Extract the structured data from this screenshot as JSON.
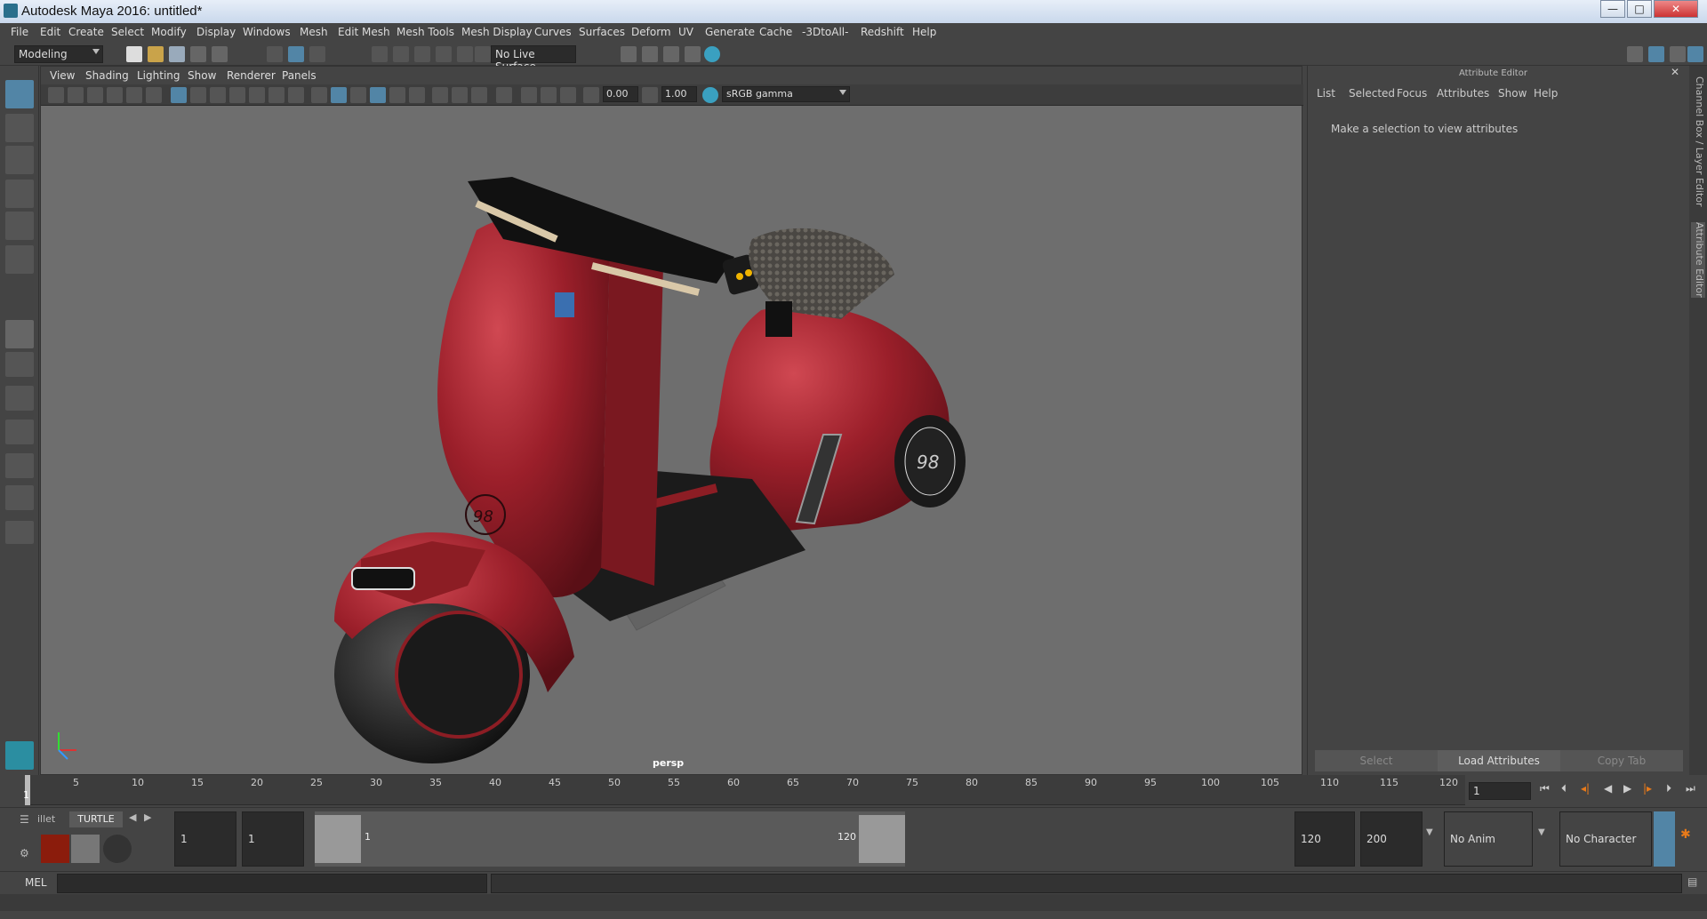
{
  "window": {
    "title": "Autodesk Maya 2016: untitled*",
    "minimize": "—",
    "maximize": "□",
    "close": "✕"
  },
  "menu": [
    "File",
    "Edit",
    "Create",
    "Select",
    "Modify",
    "Display",
    "Windows",
    "Mesh",
    "Edit Mesh",
    "Mesh Tools",
    "Mesh Display",
    "Curves",
    "Surfaces",
    "Deform",
    "UV",
    "Generate",
    "Cache",
    "-3DtoAll-",
    "Redshift",
    "Help"
  ],
  "status": {
    "menuset": "Modeling",
    "live_surface": "No Live Surface"
  },
  "panel_menu": [
    "View",
    "Shading",
    "Lighting",
    "Show",
    "Renderer",
    "Panels"
  ],
  "panel_bar": {
    "value_a": "0.00",
    "value_b": "1.00",
    "color_space": "sRGB gamma"
  },
  "viewport": {
    "camera": "persp"
  },
  "attribute_editor": {
    "title": "Attribute Editor",
    "menus": [
      "List",
      "Selected",
      "Focus",
      "Attributes",
      "Show",
      "Help"
    ],
    "message": "Make a selection to view attributes",
    "buttons": {
      "select": "Select",
      "load": "Load Attributes",
      "copy": "Copy Tab"
    }
  },
  "side_tabs": {
    "channel_box": "Channel Box / Layer Editor",
    "attribute_editor": "Attribute Editor"
  },
  "timeline": {
    "ticks": [
      "5",
      "10",
      "15",
      "20",
      "25",
      "30",
      "35",
      "40",
      "45",
      "50",
      "55",
      "60",
      "65",
      "70",
      "75",
      "80",
      "85",
      "90",
      "95",
      "100",
      "105",
      "110",
      "115",
      "120"
    ],
    "current_frame": "1",
    "current_marker": "1"
  },
  "range": {
    "shelf_tab_a": "illet",
    "shelf_tab_b": "TURTLE",
    "start_a": "1",
    "start_b": "1",
    "slider_start": "1",
    "slider_end": "120",
    "end_a": "120",
    "end_b": "200",
    "anim_layer": "No Anim Layer",
    "char_set": "No Character Set"
  },
  "mel": {
    "label": "MEL"
  },
  "colors": {
    "accent_blue": "#5285a6",
    "scooter_red": "#8c1d24"
  }
}
